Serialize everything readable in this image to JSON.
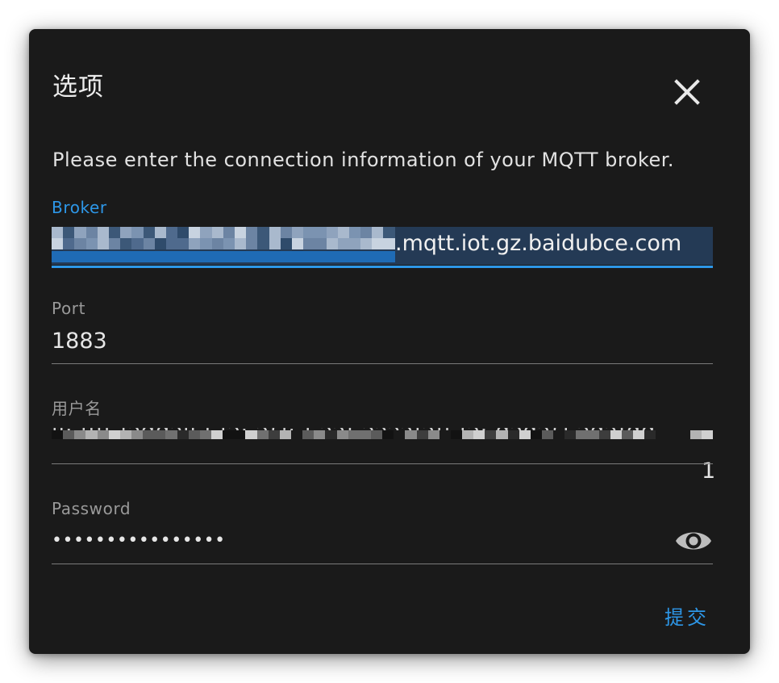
{
  "dialog": {
    "title": "选项",
    "close_icon": "close-icon",
    "description": "Please enter the connection information of your MQTT broker.",
    "submit_label": "提交"
  },
  "fields": {
    "broker": {
      "label": "Broker",
      "value_suffix": ".mqtt.iot.gz.baidubce.com",
      "focused": true
    },
    "port": {
      "label": "Port",
      "value": "1883"
    },
    "username": {
      "label": "用户名",
      "value_tail": "1"
    },
    "password": {
      "label": "Password",
      "value": "••••••••••••••••",
      "toggle_icon": "eye-icon"
    }
  },
  "colors": {
    "dialog_bg": "#1a1a1a",
    "accent": "#2d97e8",
    "text": "#e6e6e6",
    "muted": "#9a9a9a"
  }
}
